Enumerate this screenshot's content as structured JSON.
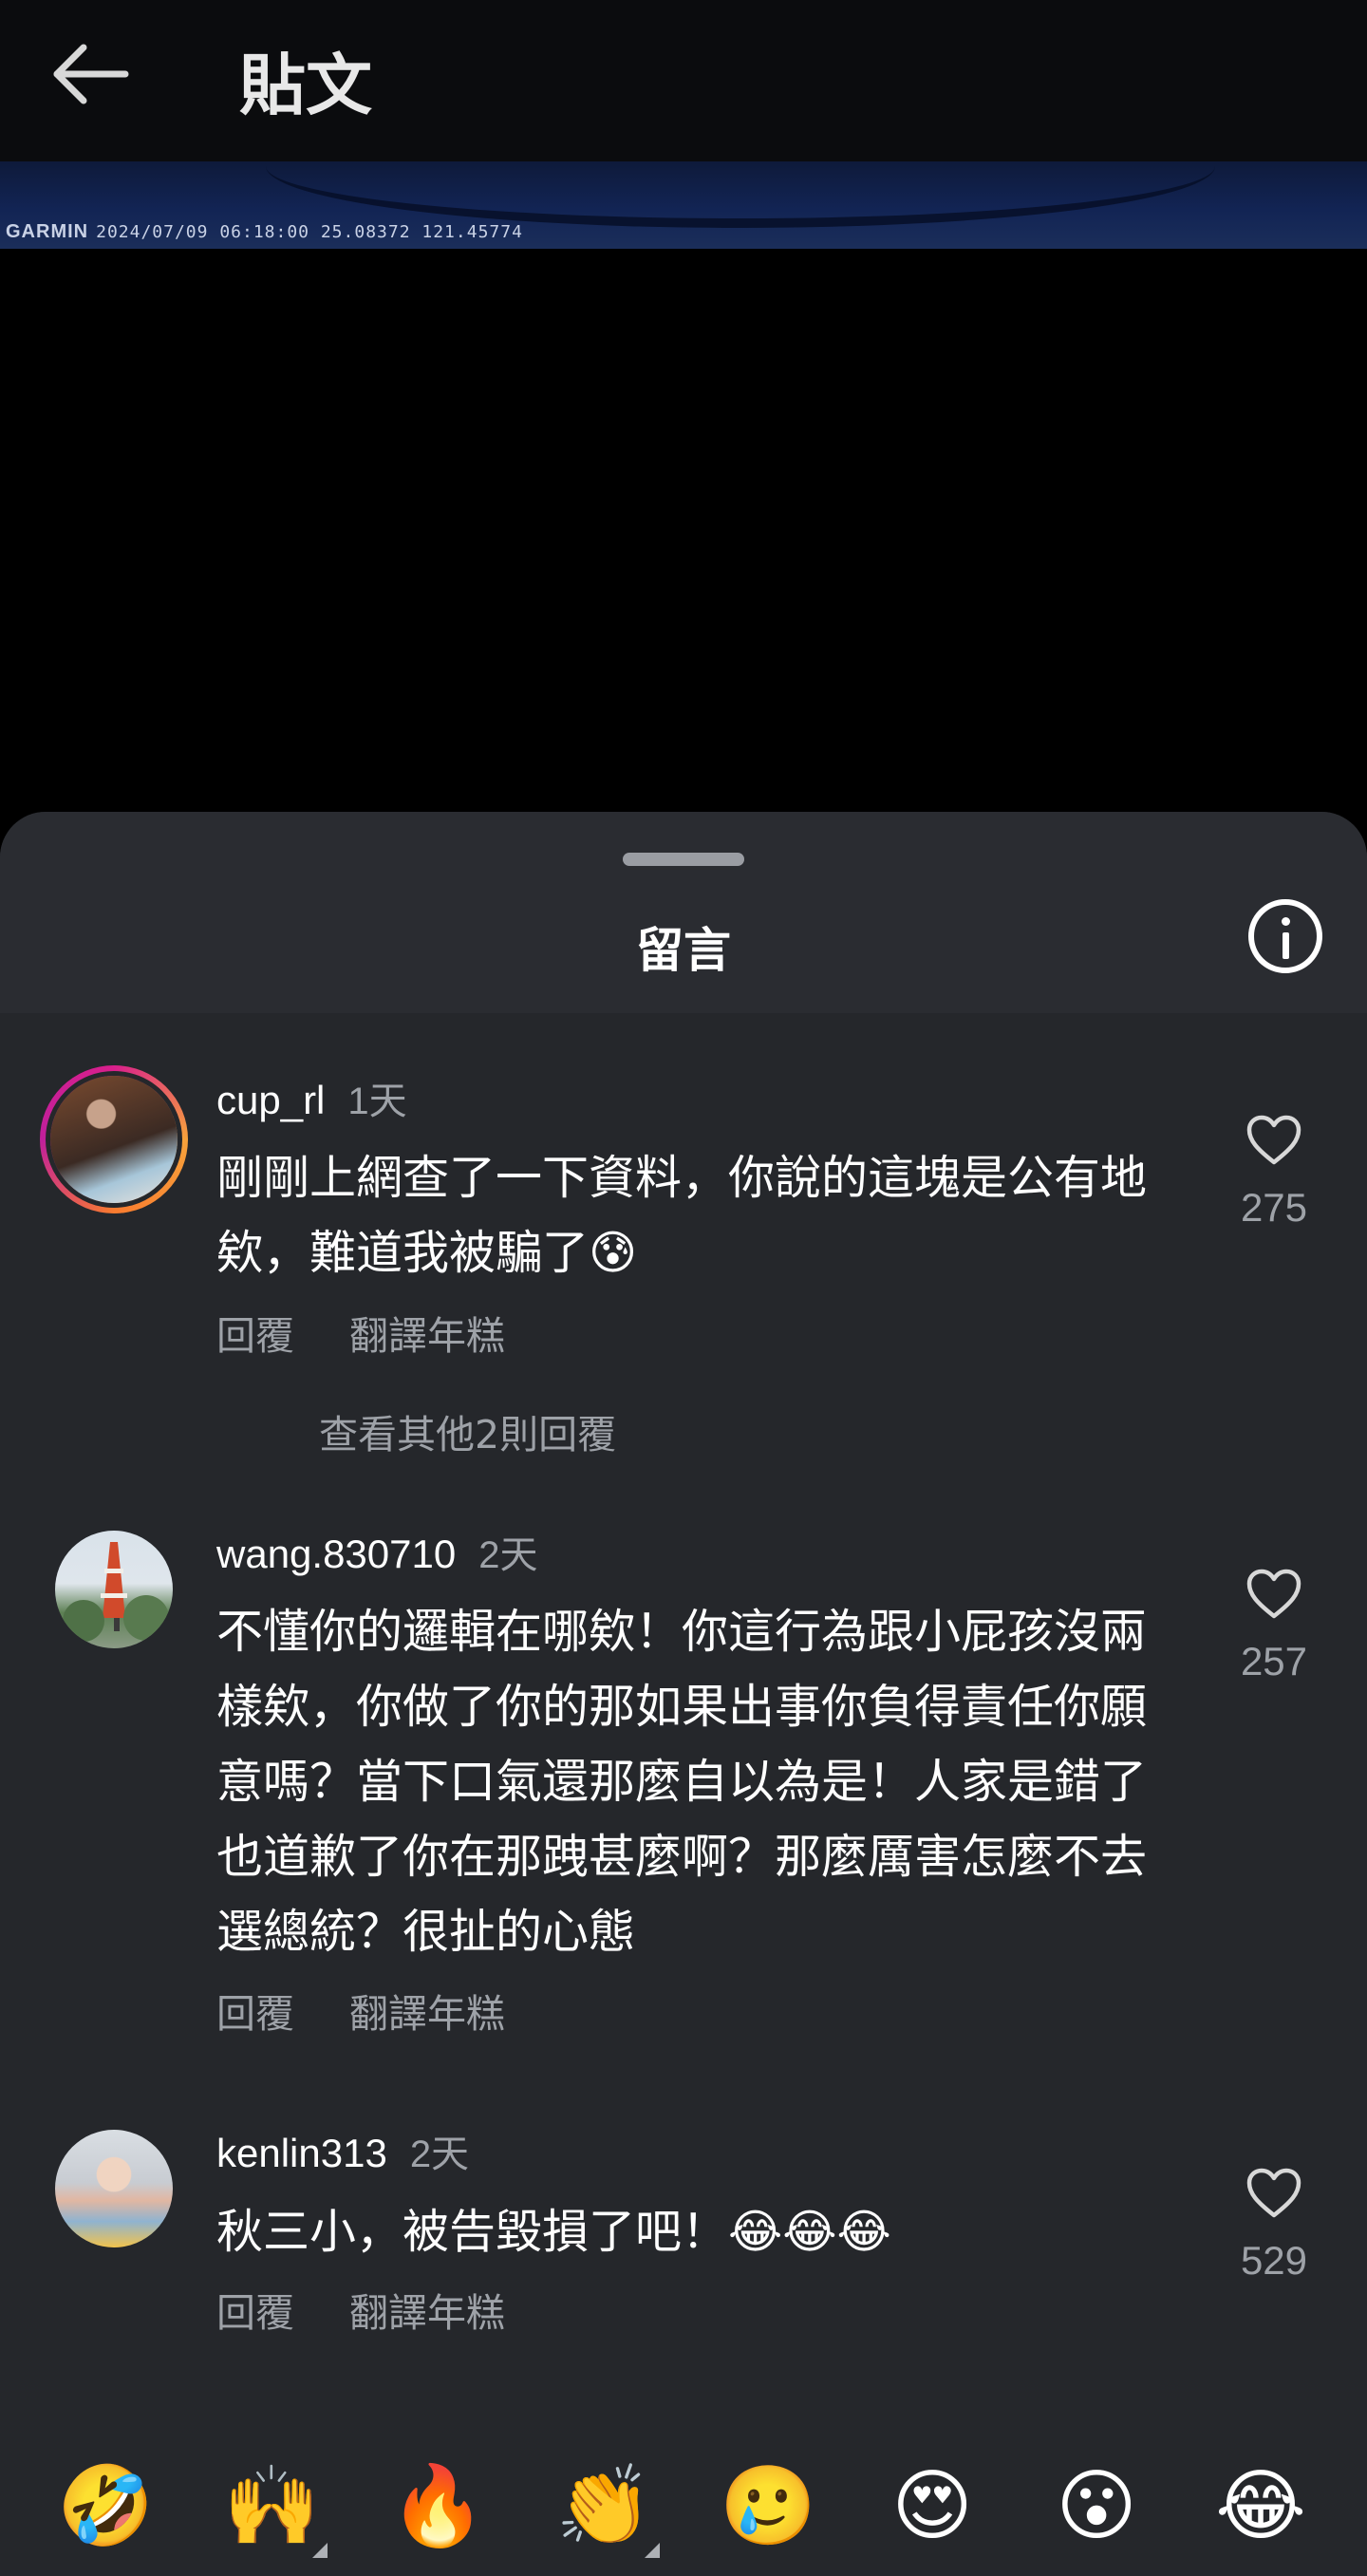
{
  "header": {
    "title": "貼文",
    "back_icon": "arrow-left-icon"
  },
  "media": {
    "caption_brand": "GARMIN",
    "caption_text": "2024/07/09 06:18:00  25.08372 121.45774"
  },
  "comments_sheet": {
    "title": "留言",
    "info_icon": "info-icon",
    "comments": [
      {
        "username": "cup_rl",
        "time": "1天",
        "text": "剛剛上網查了一下資料，你說的這塊是公有地欸，難道我被騙了😰",
        "likes": "275",
        "reply_label": "回覆",
        "translate_label": "翻譯年糕",
        "more_replies": "查看其他2則回覆",
        "has_story_ring": true
      },
      {
        "username": "wang.830710",
        "time": "2天",
        "text": "不懂你的邏輯在哪欸！你這行為跟小屁孩沒兩樣欸，你做了你的那如果出事你負得責任你願意嗎？當下口氣還那麼自以為是！人家是錯了也道歉了你在那跩甚麼啊？那麼厲害怎麼不去選總統？很扯的心態",
        "likes": "257",
        "reply_label": "回覆",
        "translate_label": "翻譯年糕"
      },
      {
        "username": "kenlin313",
        "time": "2天",
        "text": "秋三小，被告毀損了吧！😂😂😂",
        "likes": "529",
        "reply_label": "回覆",
        "translate_label": "翻譯年糕"
      }
    ]
  },
  "emoji_bar": {
    "emojis": [
      "🤣",
      "🙌",
      "🔥",
      "👏",
      "🥲",
      "😍",
      "😮",
      "😂"
    ]
  }
}
